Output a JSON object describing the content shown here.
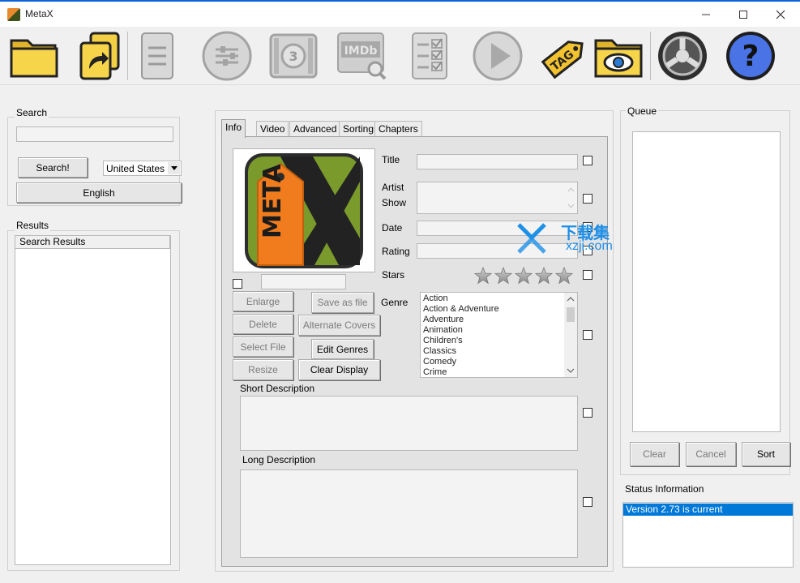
{
  "window": {
    "title": "MetaX",
    "minimize": "—",
    "maximize": "☐",
    "close": "✕"
  },
  "toolbar": {
    "icons": [
      "open-folder-icon",
      "open-file-icon",
      "file-cabinet-icon",
      "settings-sliders-icon",
      "film-countdown-icon",
      "imdb-search-icon",
      "checklist-icon",
      "play-icon",
      "auto-tag-icon",
      "watch-folder-icon",
      "update-icon",
      "help-icon"
    ]
  },
  "search": {
    "group_label": "Search",
    "input_value": "",
    "search_button": "Search!",
    "country_select": "United States",
    "language_button": "English"
  },
  "results": {
    "group_label": "Results",
    "column_header": "Search Results"
  },
  "tabs": [
    "Info",
    "Video",
    "Advanced",
    "Sorting",
    "Chapters"
  ],
  "info": {
    "cover_text": "META",
    "buttons": {
      "enlarge": "Enlarge",
      "save_as_file": "Save as file",
      "delete": "Delete",
      "alternate_covers": "Alternate Covers",
      "select_file": "Select File",
      "edit_genres": "Edit Genres",
      "resize": "Resize",
      "clear_display": "Clear Display"
    },
    "labels": {
      "title": "Title",
      "artist": "Artist",
      "show": "Show",
      "date": "Date",
      "rating": "Rating",
      "stars": "Stars",
      "genre": "Genre",
      "short_description": "Short Description",
      "long_description": "Long Description"
    },
    "stars_value": 0,
    "genres": [
      "Action",
      "Action & Adventure",
      "Adventure",
      "Animation",
      "Children's",
      "Classics",
      "Comedy",
      "Crime"
    ]
  },
  "queue": {
    "group_label": "Queue",
    "clear": "Clear",
    "cancel": "Cancel",
    "sort": "Sort"
  },
  "status": {
    "label": "Status Information",
    "lines": [
      "Version 2.73 is current"
    ]
  },
  "watermark": {
    "line1": "下载集",
    "line2": "xzji.com"
  },
  "colors": {
    "selection": "#0078d7",
    "titlebar_accent": "#0a64d8"
  }
}
